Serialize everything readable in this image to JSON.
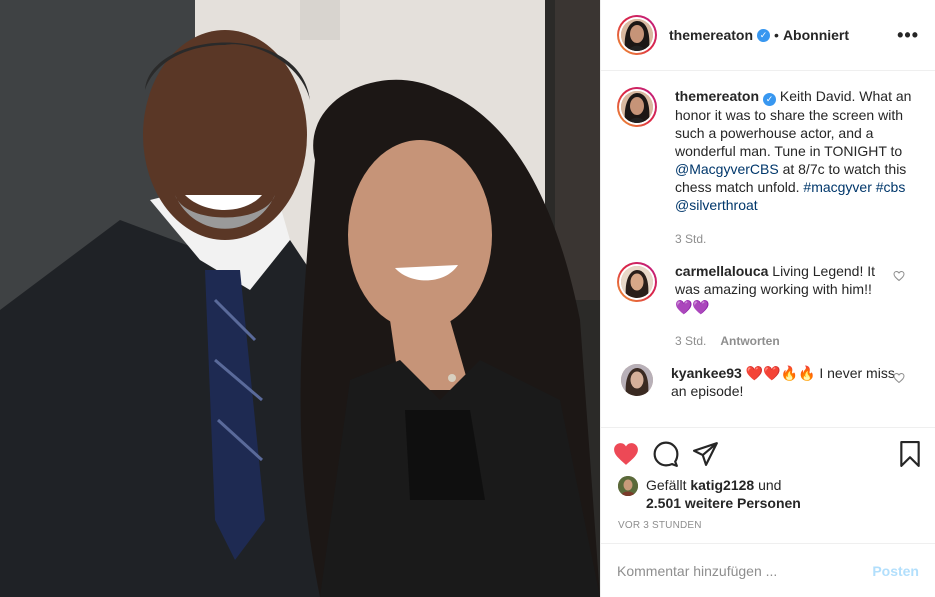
{
  "header": {
    "username": "themereaton",
    "verified_icon": "verified-badge-icon",
    "separator": "•",
    "follow_status": "Abonniert",
    "more": "•••"
  },
  "caption": {
    "username": "themereaton",
    "text_1": " Keith David. What an honor it was to share the screen with such a powerhouse actor, and a wonderful man. Tune in TONIGHT to ",
    "mention_1": "@MacgyverCBS",
    "text_2": " at 8/7c to watch this chess match unfold. ",
    "hashtag_1": "#macgyver",
    "hashtag_2": "#cbs",
    "mention_2": "@silverthroat",
    "time": "3 Std."
  },
  "comments": [
    {
      "username": "carmellalouca",
      "text": " Living Legend! It was amazing working with him!!",
      "emoji": "💜💜",
      "time": "3 Std.",
      "reply": "Antworten"
    },
    {
      "username": "kyankee93",
      "emoji": "❤️❤️🔥🔥",
      "text": " I never miss an episode!"
    }
  ],
  "likes": {
    "prefix": "Gefällt ",
    "user": "katig2128",
    "middle": " und",
    "count": "2.501 weitere Personen"
  },
  "timestamp": "VOR 3 STUNDEN",
  "add_comment": {
    "placeholder": "Kommentar hinzufügen ...",
    "post_label": "Posten"
  },
  "colors": {
    "like_red": "#ed4956",
    "link_blue": "#00376b",
    "post_disabled": "#b2dffc"
  }
}
